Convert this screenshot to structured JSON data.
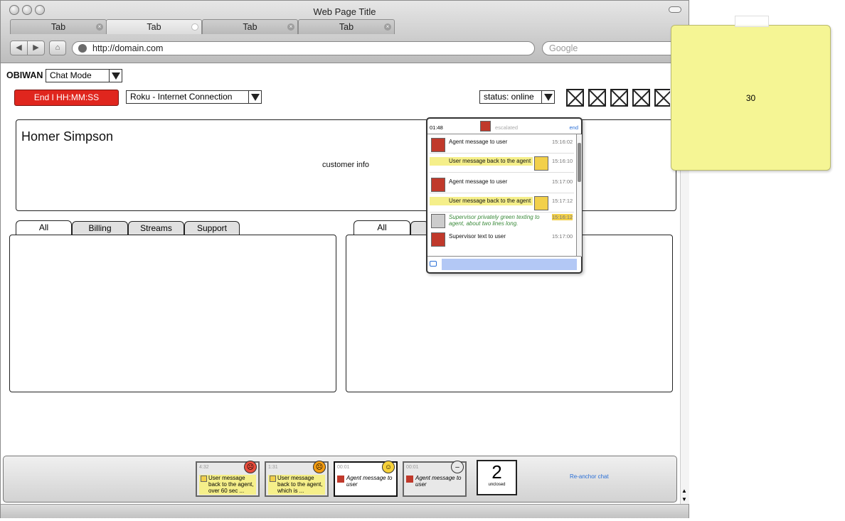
{
  "window": {
    "title": "Web Page Title"
  },
  "tabs": [
    {
      "label": "Tab"
    },
    {
      "label": "Tab"
    },
    {
      "label": "Tab"
    },
    {
      "label": "Tab"
    }
  ],
  "toolbar": {
    "url": "http://domain.com",
    "search_placeholder": "Google"
  },
  "app": {
    "name": "OBIWAN",
    "mode": "Chat Mode"
  },
  "controls": {
    "end_label": "End I HH:MM:SS",
    "connection": "Roku - Internet Connection",
    "status": "status: online"
  },
  "customer": {
    "name": "Homer Simpson",
    "info_label": "customer info"
  },
  "left_tabs": [
    "All",
    "Billing",
    "Streams",
    "Support"
  ],
  "right_tabs": [
    "All"
  ],
  "chat": {
    "timer": "01:48",
    "state": "escalated",
    "end_label": "end",
    "messages": [
      {
        "text": "Agent message to user",
        "time": "15:16:02",
        "from": "agent"
      },
      {
        "text": "User message back to the agent",
        "time": "15:16:10",
        "from": "user"
      },
      {
        "text": "Agent message to user",
        "time": "15:17:00",
        "from": "agent"
      },
      {
        "text": "User message back to the agent",
        "time": "15:17:12",
        "from": "user"
      },
      {
        "text": "Supervisor privately green texting to agent, about two lines long.",
        "time": "15:16:12",
        "from": "supervisor-private"
      },
      {
        "text": "Supervisor text to user",
        "time": "15:17:00",
        "from": "supervisor"
      }
    ]
  },
  "sticky": {
    "text": "30"
  },
  "dock": {
    "chats": [
      {
        "time": "4:32",
        "text": "User message back to the agent, over 60 sec ...",
        "mood": "angry"
      },
      {
        "time": "1:31",
        "text": "User message back to the agent, which is ...",
        "mood": "sad"
      },
      {
        "time": "00:01",
        "text": "Agent message to user",
        "mood": "happy"
      },
      {
        "time": "00:01",
        "text": "Agent message to user",
        "mood": "neutral"
      }
    ],
    "unclosed_count": "2",
    "unclosed_label": "unclosed",
    "reanchor_label": "Re-anchor chat"
  },
  "colors": {
    "end_button": "#e0261e",
    "user_highlight": "#f5ef8a",
    "supervisor_text": "#3a8a3a",
    "link": "#2a6fd6",
    "chat_input": "#b3c8f5"
  }
}
